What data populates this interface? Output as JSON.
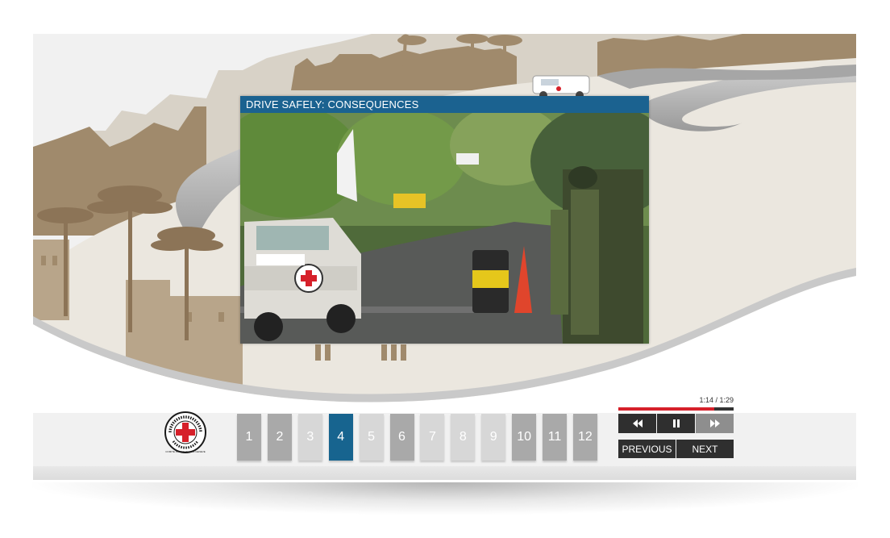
{
  "video": {
    "title": "DRIVE SAFELY: CONSEQUENCES",
    "time": "1:14 / 1:29",
    "progress_fraction": 0.83
  },
  "chapters": [
    {
      "label": "1",
      "state": "visited"
    },
    {
      "label": "2",
      "state": "visited"
    },
    {
      "label": "3",
      "state": "unvisited"
    },
    {
      "label": "4",
      "state": "active"
    },
    {
      "label": "5",
      "state": "unvisited"
    },
    {
      "label": "6",
      "state": "visited"
    },
    {
      "label": "7",
      "state": "unvisited"
    },
    {
      "label": "8",
      "state": "unvisited"
    },
    {
      "label": "9",
      "state": "unvisited"
    },
    {
      "label": "10",
      "state": "visited"
    },
    {
      "label": "11",
      "state": "visited"
    },
    {
      "label": "12",
      "state": "visited"
    }
  ],
  "controls": {
    "rewind_icon": "rewind-icon",
    "pause_icon": "pause-icon",
    "forward_icon": "fast-forward-icon"
  },
  "nav": {
    "previous_label": "PREVIOUS",
    "next_label": "NEXT"
  },
  "logo": {
    "text": "COMITE INTERNATIONAL GENEVE",
    "icon": "red-cross-icon"
  },
  "colors": {
    "accent": "#17648f",
    "progress": "#d6202a",
    "scenery_tan": "#a08a6c"
  }
}
